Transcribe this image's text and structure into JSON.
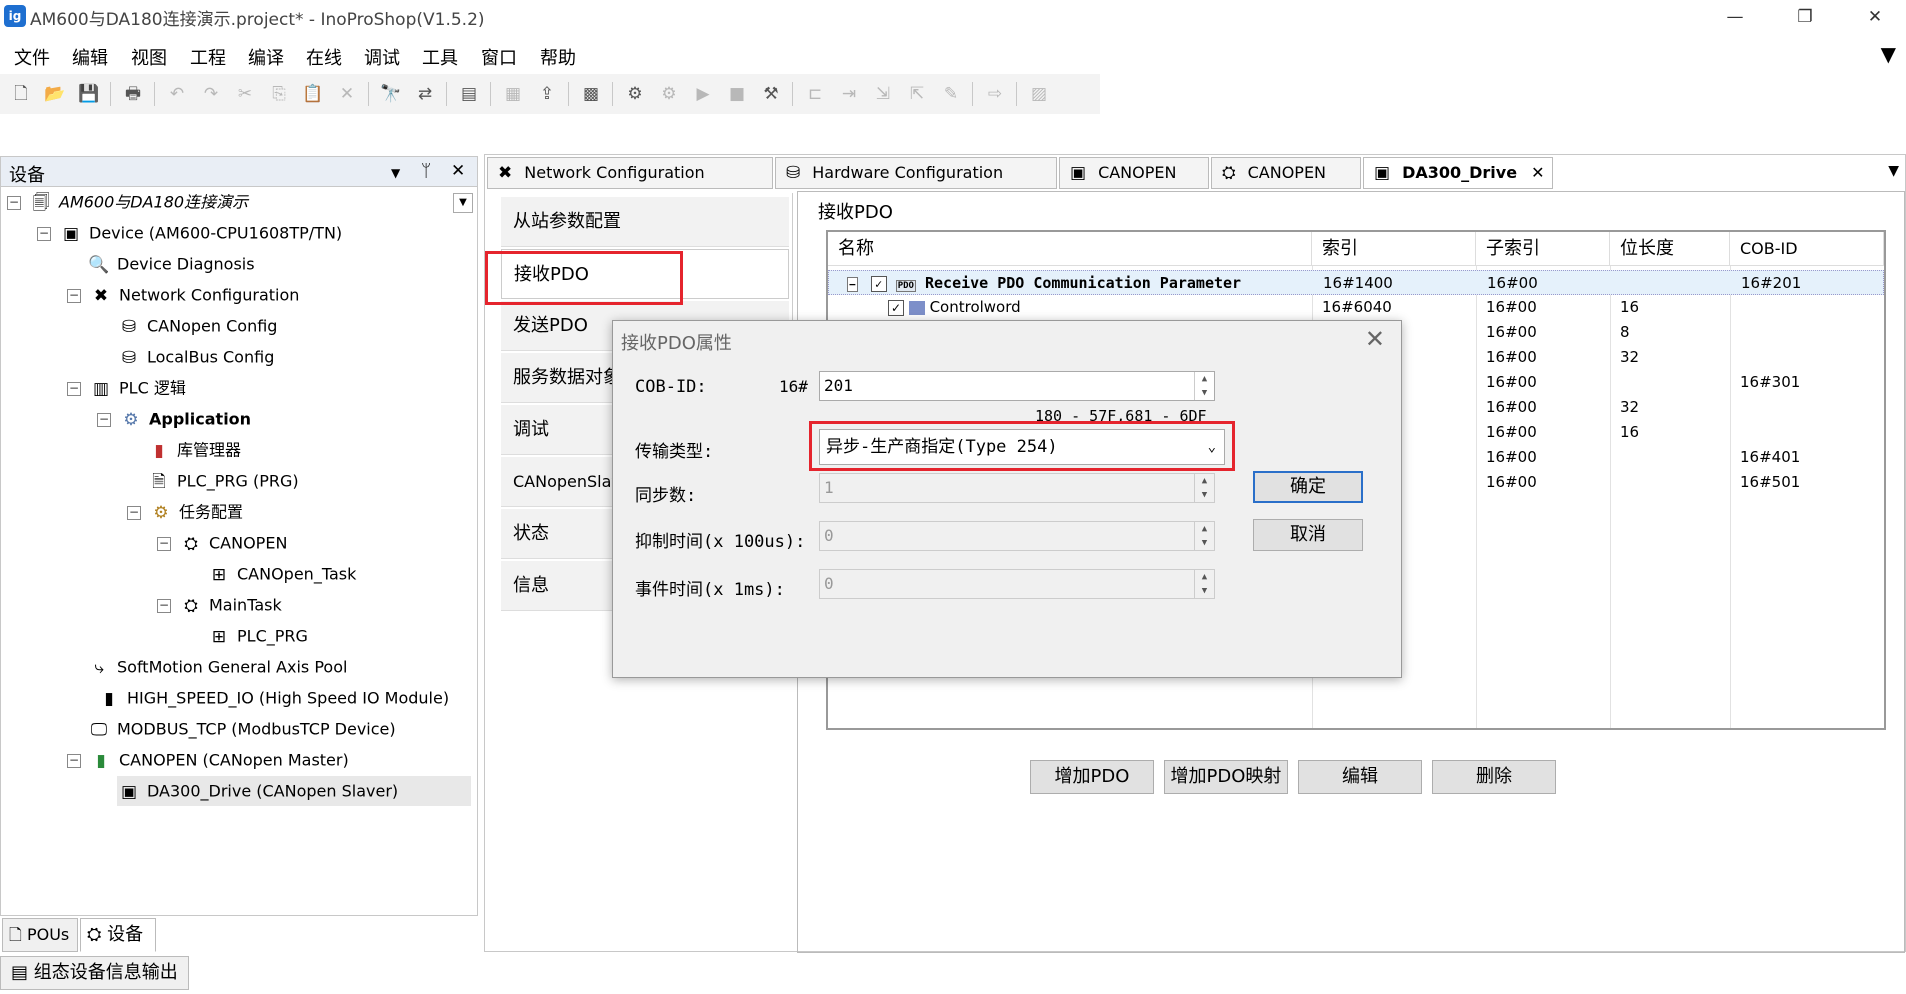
{
  "window": {
    "app_icon_text": "ig",
    "title": "AM600与DA180连接演示.project* - InoProShop(V1.5.2)",
    "minimize": "—",
    "restore": "❐",
    "close": "✕"
  },
  "menu": [
    "文件",
    "编辑",
    "视图",
    "工程",
    "编译",
    "在线",
    "调试",
    "工具",
    "窗口",
    "帮助"
  ],
  "menu_filter_icon": "▼",
  "left_panel": {
    "title": "设备",
    "dropdown": "▼",
    "pin": "ᛘ",
    "close": "✕",
    "tree": [
      {
        "label": "AM600与DA180连接演示",
        "indent": 0,
        "toggle": "−",
        "icon": "project-icon"
      },
      {
        "label": "Device (AM600-CPU1608TP/TN)",
        "indent": 1,
        "toggle": "−",
        "icon": "device-icon"
      },
      {
        "label": "Device Diagnosis",
        "indent": 2,
        "toggle": "",
        "icon": "diagnosis-icon"
      },
      {
        "label": "Network Configuration",
        "indent": 2,
        "toggle": "−",
        "icon": "network-icon"
      },
      {
        "label": "CANopen Config",
        "indent": 3,
        "toggle": "",
        "icon": "config-icon"
      },
      {
        "label": "LocalBus Config",
        "indent": 3,
        "toggle": "",
        "icon": "config-icon"
      },
      {
        "label": "PLC 逻辑",
        "indent": 2,
        "toggle": "−",
        "icon": "plc-icon"
      },
      {
        "label": "Application",
        "indent": 3,
        "toggle": "−",
        "icon": "application-icon"
      },
      {
        "label": "库管理器",
        "indent": 4,
        "toggle": "",
        "icon": "library-icon"
      },
      {
        "label": "PLC_PRG (PRG)",
        "indent": 4,
        "toggle": "",
        "icon": "program-icon"
      },
      {
        "label": "任务配置",
        "indent": 4,
        "toggle": "−",
        "icon": "task-config-icon"
      },
      {
        "label": "CANOPEN",
        "indent": 5,
        "toggle": "−",
        "icon": "task-icon"
      },
      {
        "label": "CANOpen_Task",
        "indent": 6,
        "toggle": "",
        "icon": "task-item-icon"
      },
      {
        "label": "MainTask",
        "indent": 5,
        "toggle": "−",
        "icon": "task-icon"
      },
      {
        "label": "PLC_PRG",
        "indent": 6,
        "toggle": "",
        "icon": "task-item-icon"
      },
      {
        "label": "SoftMotion General Axis Pool",
        "indent": 2,
        "toggle": "",
        "icon": "axis-pool-icon"
      },
      {
        "label": "HIGH_SPEED_IO (High Speed IO Module)",
        "indent": 2,
        "toggle": "",
        "icon": "io-module-icon"
      },
      {
        "label": "MODBUS_TCP (ModbusTCP Device)",
        "indent": 2,
        "toggle": "",
        "icon": "modbus-icon"
      },
      {
        "label": "CANOPEN (CANopen Master)",
        "indent": 2,
        "toggle": "−",
        "icon": "canopen-master-icon"
      },
      {
        "label": "DA300_Drive (CANopen Slaver)",
        "indent": 3,
        "toggle": "",
        "icon": "drive-icon"
      }
    ],
    "bottom_tabs": [
      "POUs",
      "设备"
    ],
    "output_tab": "组态设备信息输出"
  },
  "editor_tabs": [
    {
      "label": "Network Configuration",
      "icon": "network-icon"
    },
    {
      "label": "Hardware Configuration",
      "icon": "hardware-icon"
    },
    {
      "label": "CANOPEN",
      "icon": "device-icon"
    },
    {
      "label": "CANOPEN",
      "icon": "task-icon"
    },
    {
      "label": "DA300_Drive",
      "icon": "drive-icon",
      "close": "✕"
    }
  ],
  "editor_tabs_dropdown": "▼",
  "side_tabs": [
    "从站参数配置",
    "接收PDO",
    "发送PDO",
    "服务数据对象",
    "调试",
    "CANopenSlav",
    "状态",
    "信息"
  ],
  "pdo_group_label": "接收PDO",
  "pdo_table": {
    "headers": [
      "名称",
      "索引",
      "子索引",
      "位长度",
      "COB-ID"
    ],
    "rows": [
      {
        "name": "Receive PDO Communication Parameter",
        "index": "16#1400",
        "sub": "16#00",
        "bits": "",
        "cob": "16#201"
      },
      {
        "name": "Controlword",
        "index": "16#6040",
        "sub": "16#00",
        "bits": "16",
        "cob": ""
      },
      {
        "name": "",
        "index": "",
        "sub": "16#00",
        "bits": "8",
        "cob": ""
      },
      {
        "name": "",
        "index": "",
        "sub": "16#00",
        "bits": "32",
        "cob": ""
      },
      {
        "name": "",
        "index": "",
        "sub": "16#00",
        "bits": "",
        "cob": "16#301"
      },
      {
        "name": "",
        "index": "",
        "sub": "16#00",
        "bits": "32",
        "cob": ""
      },
      {
        "name": "",
        "index": "",
        "sub": "16#00",
        "bits": "16",
        "cob": ""
      },
      {
        "name": "",
        "index": "",
        "sub": "16#00",
        "bits": "",
        "cob": "16#401"
      },
      {
        "name": "",
        "index": "",
        "sub": "16#00",
        "bits": "",
        "cob": "16#501"
      }
    ],
    "pdo_badge": "PDO"
  },
  "pdo_buttons": [
    "增加PDO",
    "增加PDO映射",
    "编辑",
    "删除"
  ],
  "dialog": {
    "title": "接收PDO属性",
    "close": "✕",
    "cob_id_label": "COB-ID:",
    "cob_prefix": "16#",
    "cob_value": "201",
    "cob_range": "180 - 57F,681 - 6DF",
    "transmission_label": "传输类型:",
    "transmission_value": "异步-生产商指定(Type 254)",
    "sync_label": "同步数:",
    "sync_value": "1",
    "inhibit_label": "抑制时间(x 100us):",
    "inhibit_value": "0",
    "event_label": "事件时间(x 1ms):",
    "event_value": "0",
    "ok": "确定",
    "cancel": "取消"
  },
  "accent_colors": {
    "highlight": "#e5242d",
    "selection": "#e5f1fb",
    "title_icon": "#1e6fd0"
  }
}
